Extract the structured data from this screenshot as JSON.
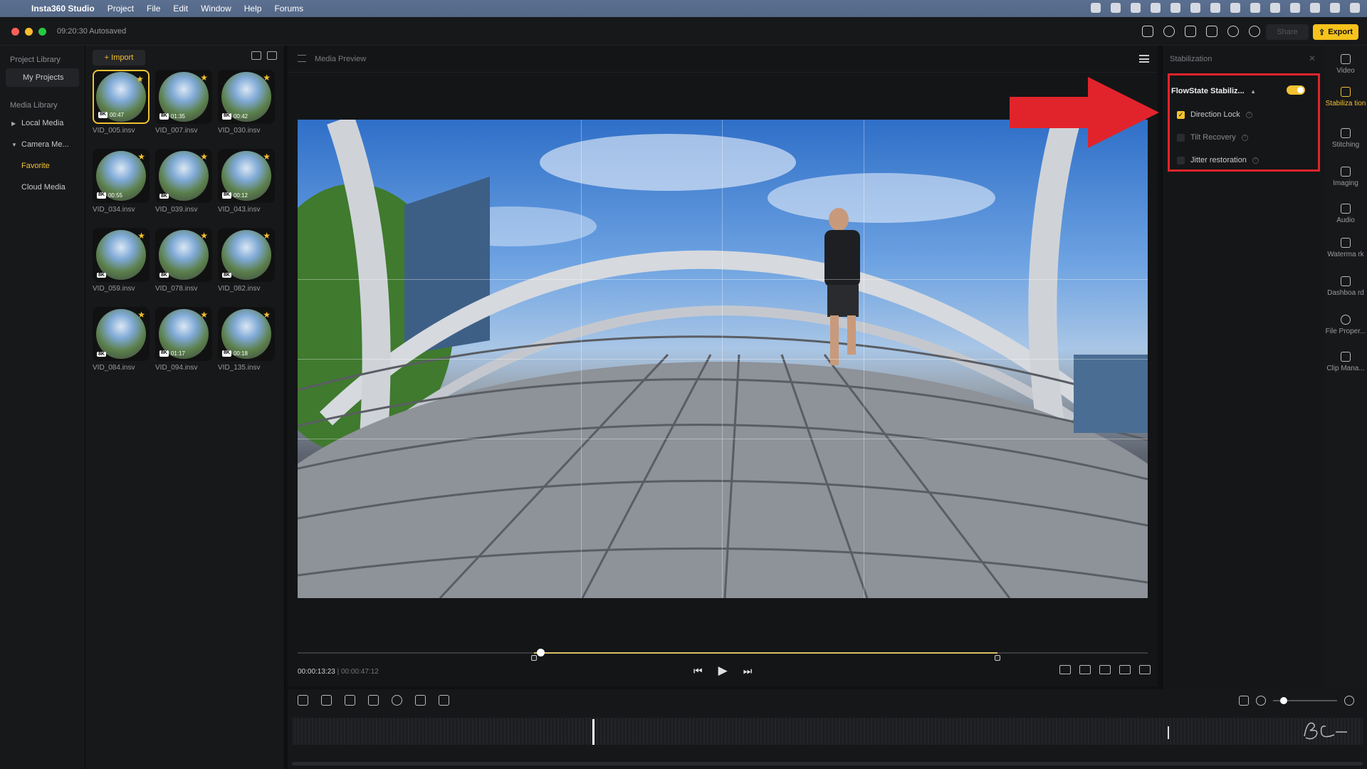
{
  "menubar": {
    "items": [
      "Insta360 Studio",
      "Project",
      "File",
      "Edit",
      "Window",
      "Help",
      "Forums"
    ]
  },
  "titlebar": {
    "autosave": "09:20:30 Autosaved",
    "share_label": "Share",
    "export_label": "Export"
  },
  "library": {
    "project_section": "Project Library",
    "my_projects": "My Projects",
    "media_section": "Media Library",
    "local_media": "Local Media",
    "camera_media": "Camera Me...",
    "favorite": "Favorite",
    "cloud_media": "Cloud Media"
  },
  "media": {
    "import_label": "+ Import",
    "clips": [
      {
        "name": "VID_005.insv",
        "res": "8K",
        "dur": "00:47"
      },
      {
        "name": "VID_007.insv",
        "res": "8K",
        "dur": "01:35"
      },
      {
        "name": "VID_030.insv",
        "res": "8K",
        "dur": "00:42"
      },
      {
        "name": "VID_034.insv",
        "res": "8K",
        "dur": "00:55"
      },
      {
        "name": "VID_039.insv",
        "res": "8K",
        "dur": ""
      },
      {
        "name": "VID_043.insv",
        "res": "8K",
        "dur": "00:12"
      },
      {
        "name": "VID_059.insv",
        "res": "8K",
        "dur": ""
      },
      {
        "name": "VID_078.insv",
        "res": "8K",
        "dur": ""
      },
      {
        "name": "VID_082.insv",
        "res": "8K",
        "dur": ""
      },
      {
        "name": "VID_084.insv",
        "res": "8K",
        "dur": ""
      },
      {
        "name": "VID_094.insv",
        "res": "8K",
        "dur": "01:17"
      },
      {
        "name": "VID_135.insv",
        "res": "8K",
        "dur": "00:18"
      }
    ]
  },
  "preview": {
    "title": "Media Preview",
    "current_time": "00:00:13:23",
    "duration": "00:00:47:12",
    "progress": 0.286,
    "trim_start": 0.278,
    "trim_end": 0.823
  },
  "stabilization": {
    "title": "Stabilization",
    "flowstate_label": "FlowState Stabiliz...",
    "flowstate_on": true,
    "options": [
      {
        "label": "Direction Lock",
        "checked": true
      },
      {
        "label": "Tilt Recovery",
        "checked": false
      },
      {
        "label": "Jitter restoration",
        "checked": false
      }
    ]
  },
  "rail": {
    "items": [
      "Video",
      "Stabiliza tion",
      "Stitching",
      "Imaging",
      "Audio",
      "Waterma rk",
      "Dashboa rd",
      "File Proper...",
      "Clip Mana..."
    ]
  },
  "colors": {
    "accent": "#f2c230",
    "highlight": "#e1242b"
  }
}
